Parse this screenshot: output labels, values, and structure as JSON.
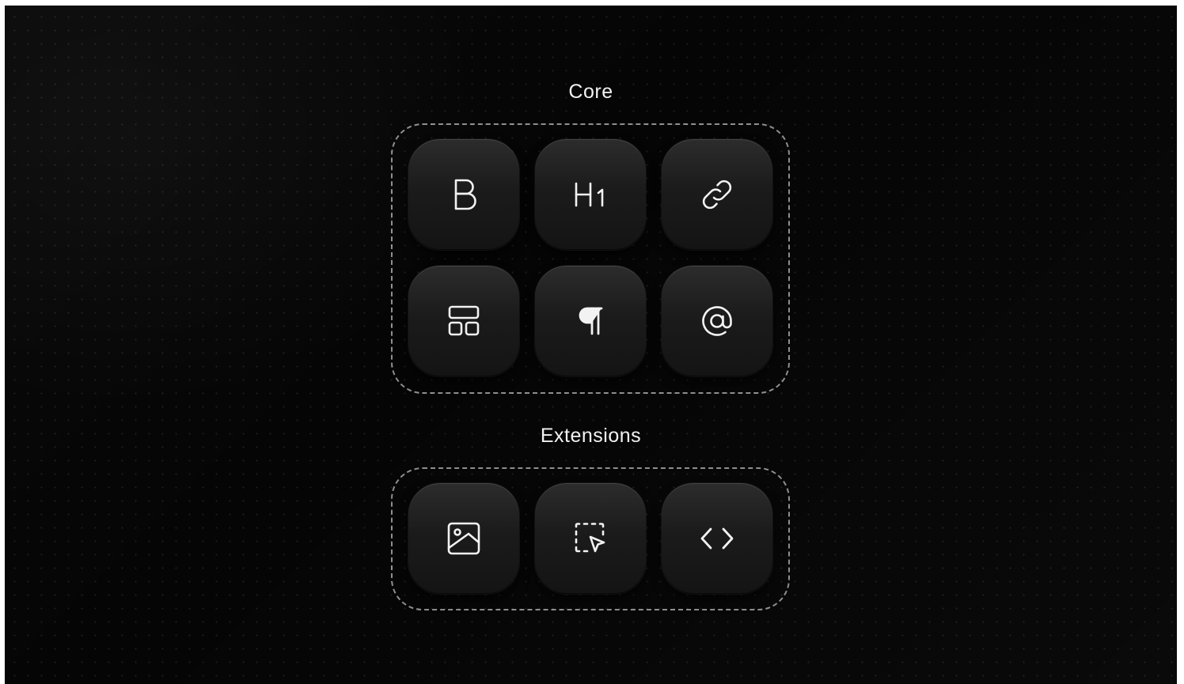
{
  "sections": {
    "core": {
      "title": "Core",
      "tiles": [
        {
          "icon": "bold-icon",
          "label": "B"
        },
        {
          "icon": "heading-icon",
          "label": "H1"
        },
        {
          "icon": "link-icon"
        },
        {
          "icon": "layout-icon"
        },
        {
          "icon": "paragraph-icon",
          "label": "¶"
        },
        {
          "icon": "mention-icon",
          "label": "@"
        }
      ]
    },
    "extensions": {
      "title": "Extensions",
      "tiles": [
        {
          "icon": "image-icon"
        },
        {
          "icon": "selection-cursor-icon"
        },
        {
          "icon": "code-icon"
        }
      ]
    }
  },
  "colors": {
    "background": "#050505",
    "tile": "#1b1b1b",
    "foreground": "#f2f2f2",
    "border_dashed": "#8c8c8c"
  }
}
